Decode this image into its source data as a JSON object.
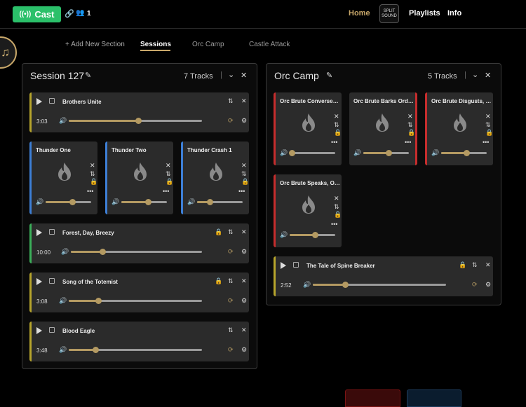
{
  "topbar": {
    "cast_label": "Cast",
    "users_count": "1",
    "nav": {
      "home": "Home",
      "playlists": "Playlists",
      "info": "Info"
    },
    "logo_text": "SPLIT SOUND"
  },
  "tabs": {
    "add_section": "+ Add New Section",
    "items": [
      "Sessions",
      "Orc Camp",
      "Castle Attack"
    ],
    "active": "Sessions"
  },
  "colors": {
    "accent": "#c9a86a",
    "cast": "#2bc06a",
    "yellow_stripe": "#b7a52c",
    "blue_stripe": "#3d7fd6",
    "green_stripe": "#3bb05a",
    "red_stripe": "#c62d2d"
  },
  "session": {
    "title": "Session 127",
    "count": "7 Tracks",
    "tracks": [
      {
        "name": "Brothers Unite",
        "time": "3:03",
        "volume": 0.52
      },
      {
        "name": "Forest, Day, Breezy",
        "time": "10:00",
        "volume": 0.24
      },
      {
        "name": "Song of the Totemist",
        "time": "3:08",
        "volume": 0.22
      },
      {
        "name": "Blood Eagle",
        "time": "3:48",
        "volume": 0.2
      }
    ],
    "tiles": [
      {
        "name": "Thunder One",
        "volume": 0.58
      },
      {
        "name": "Thunder Two",
        "volume": 0.58
      },
      {
        "name": "Thunder Crash 1",
        "volume": 0.28
      }
    ]
  },
  "orc": {
    "title": "Orc Camp",
    "count": "5 Tracks",
    "tiles": [
      {
        "name": "Orc Brute Converse…",
        "volume": 0.05
      },
      {
        "name": "Orc Brute Barks Ord…",
        "volume": 0.55
      },
      {
        "name": "Orc Brute Disgusts, …",
        "volume": 0.55
      },
      {
        "name": "Orc Brute Speaks, O…",
        "volume": 0.55
      }
    ],
    "track": {
      "name": "The Tale of Spine Breaker",
      "time": "2:52",
      "volume": 0.24
    }
  }
}
